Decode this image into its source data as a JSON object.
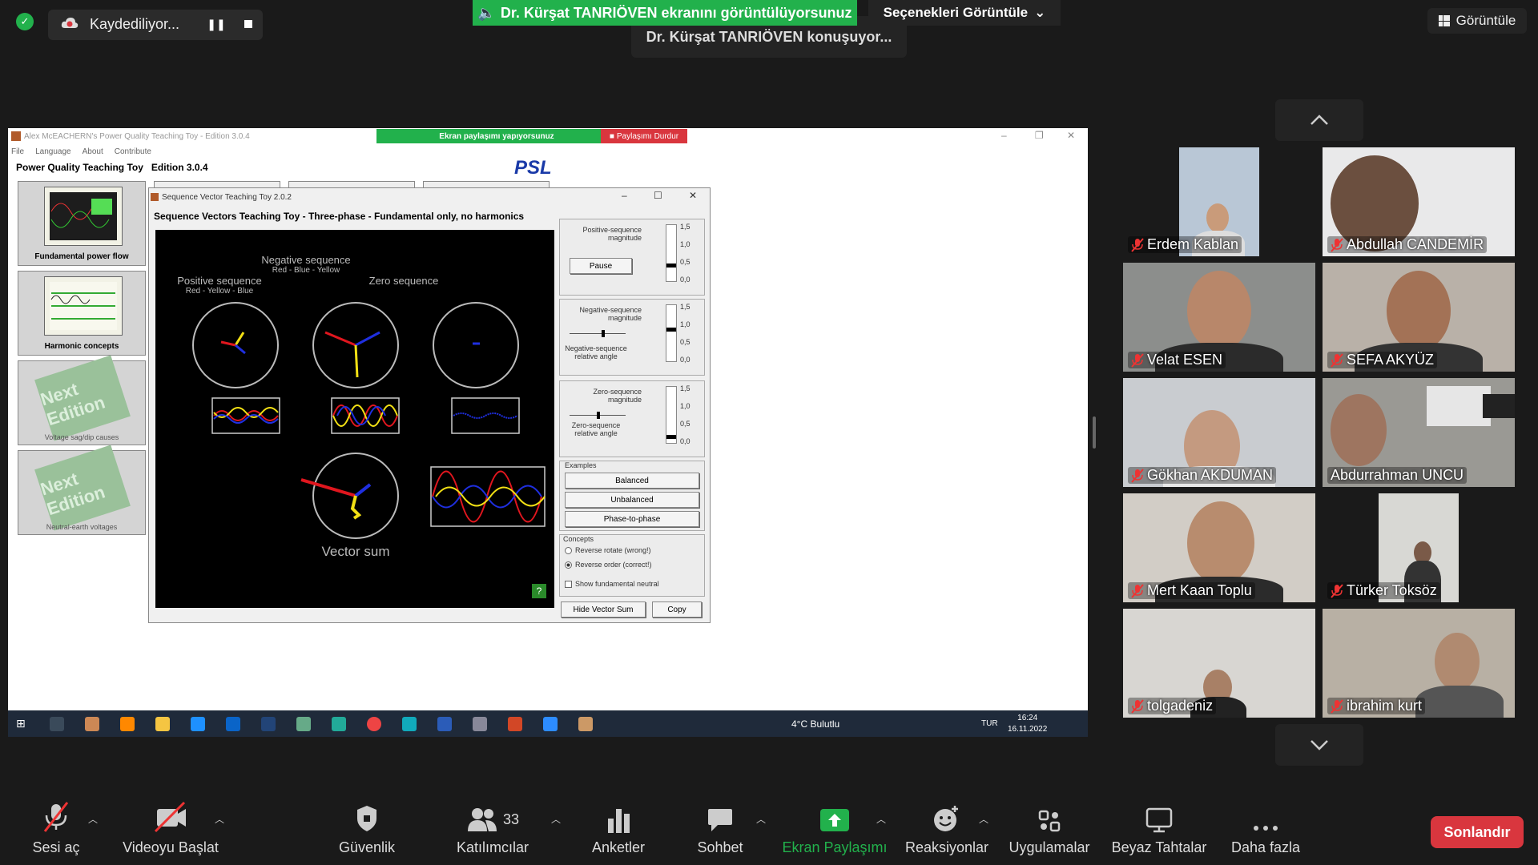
{
  "recording": {
    "label": "Kaydediliyor...",
    "pause_glyph": "❚❚"
  },
  "share_banner": {
    "text": "Dr. Kürşat TANRIÖVEN ekranını görüntülüyorsunuz"
  },
  "options_button": {
    "label": "Seçenekleri Görüntüle"
  },
  "speaking": {
    "text": "Dr. Kürşat TANRIÖVEN konuşuyor..."
  },
  "view_button": {
    "label": "Görüntüle"
  },
  "shared_screen": {
    "window_title": "Alex McEACHERN's Power Quality Teaching Toy - Edition 3.0.4",
    "inner_share_text": "Ekran paylaşımı yapıyorsunuz",
    "inner_stop_text": "Paylaşımı Durdur",
    "menu": [
      "File",
      "Language",
      "About",
      "Contribute"
    ],
    "app_header": "Power Quality Teaching Toy   Edition 3.0.4",
    "logo": "PSL",
    "thumbnails": [
      {
        "caption": "Fundamental power flow"
      },
      {
        "caption": "Harmonic concepts"
      },
      {
        "overlay": "Next Edition",
        "caption": "Voltage sag/dip causes"
      },
      {
        "overlay": "Next Edition",
        "caption": "Neutral-earth voltages"
      }
    ],
    "dialog": {
      "title": "Sequence Vector Teaching Toy 2.0.2",
      "heading": "Sequence Vectors Teaching Toy - Three-phase - Fundamental only, no harmonics",
      "controls": {
        "minimize": "–",
        "maximize": "☐",
        "close": "✕"
      },
      "canvas": {
        "positive_title": "Positive sequence",
        "positive_sub": "Red - Yellow - Blue",
        "negative_title": "Negative sequence",
        "negative_sub": "Red - Blue - Yellow",
        "zero_title": "Zero sequence",
        "vector_sum": "Vector sum"
      },
      "scale_ticks": [
        "1,5",
        "1,0",
        "0,5",
        "0,0"
      ],
      "positive_panel": {
        "label": "Positive-sequence magnitude",
        "pause": "Pause"
      },
      "negative_panel": {
        "label": "Negative-sequence magnitude",
        "angle_label": "Negative-sequence relative angle"
      },
      "zero_panel": {
        "label": "Zero-sequence magnitude",
        "angle_label": "Zero-sequence relative angle"
      },
      "examples": {
        "title": "Examples",
        "buttons": [
          "Balanced",
          "Unbalanced",
          "Phase-to-phase"
        ]
      },
      "concepts": {
        "title": "Concepts",
        "reverse_rotate": "Reverse rotate (wrong!)",
        "reverse_order": "Reverse order (correct!)",
        "show_neutral": "Show fundamental neutral"
      },
      "hide_vector_sum": "Hide Vector Sum",
      "copy": "Copy",
      "help": "?"
    },
    "taskbar": {
      "weather": "4°C  Bulutlu",
      "lang": "TUR",
      "time": "16:24",
      "date": "16.11.2022"
    }
  },
  "participants": [
    {
      "name": "Erdem Kablan"
    },
    {
      "name": "Abdullah CANDEMİR"
    },
    {
      "name": "Velat ESEN"
    },
    {
      "name": "SEFA AKYÜZ"
    },
    {
      "name": "Gökhan AKDUMAN"
    },
    {
      "name": "Abdurrahman UNCU"
    },
    {
      "name": "Mert Kaan Toplu"
    },
    {
      "name": "Türker Toksöz"
    },
    {
      "name": "tolgadeniz"
    },
    {
      "name": "ibrahim kurt"
    }
  ],
  "toolbar": {
    "mute": "Sesi aç",
    "video": "Videoyu Başlat",
    "security": "Güvenlik",
    "participants": "Katılımcılar",
    "participants_count": "33",
    "polls": "Anketler",
    "chat": "Sohbet",
    "share": "Ekran Paylaşımı",
    "reactions": "Reaksiyonlar",
    "apps": "Uygulamalar",
    "whiteboards": "Beyaz Tahtalar",
    "more": "Daha fazla",
    "end": "Sonlandır"
  },
  "colors": {
    "zoom_green": "#22b14c",
    "end_red": "#d9363e",
    "phase_red": "#e0161e",
    "phase_yellow": "#f2e014",
    "phase_blue": "#1f2fe0"
  }
}
